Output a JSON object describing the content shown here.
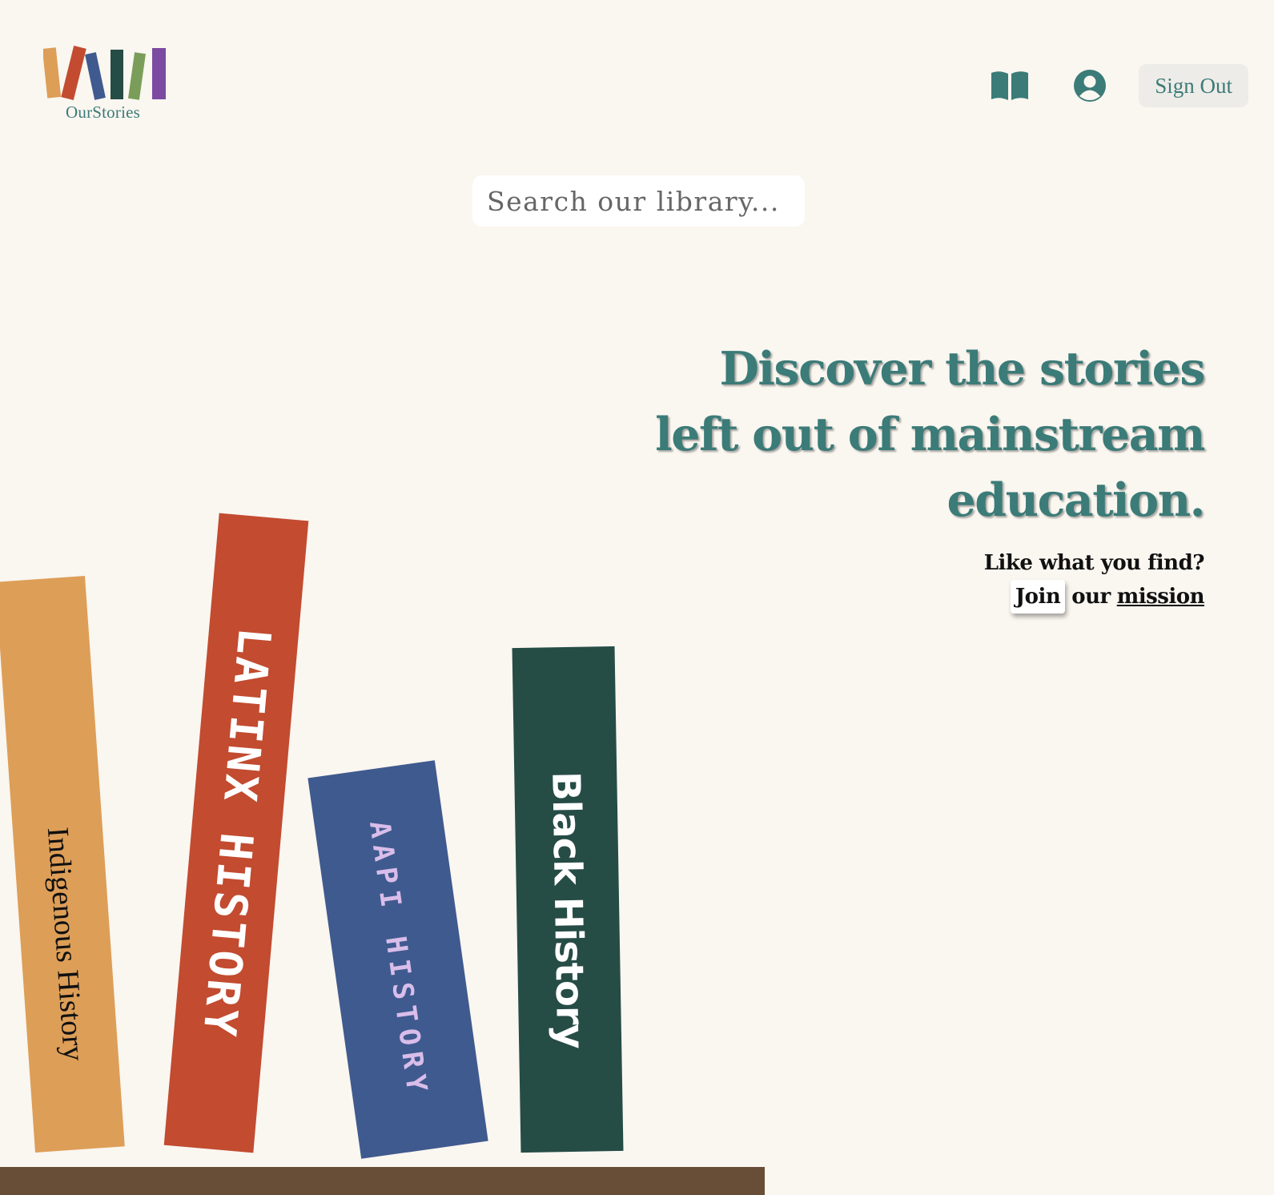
{
  "brand": {
    "name": "OurStories",
    "logo_bar_colors": [
      "#dd9e57",
      "#c24b30",
      "#3f5a8e",
      "#264c46",
      "#7a9e59",
      "#7c4aa0"
    ]
  },
  "nav": {
    "library_icon": "open-book-icon",
    "account_icon": "user-circle-icon",
    "sign_out_label": "Sign Out"
  },
  "search": {
    "placeholder": "Search our library..."
  },
  "hero": {
    "headline_lines": [
      "Discover the stories",
      "left out of mainstream",
      "education."
    ],
    "prompt": "Like what you find?",
    "join_label": "Join",
    "our_text": "our",
    "mission_label": "mission"
  },
  "books": [
    {
      "label": "Indigenous History",
      "color": "#dd9e57",
      "text_color": "#111111"
    },
    {
      "label": "LATINX HISTORY",
      "color": "#c24b30",
      "text_color": "#ffffff"
    },
    {
      "label": "AAPI HISTORY",
      "color": "#3f5a8e",
      "text_color": "#d9bdea"
    },
    {
      "label": "Black History",
      "color": "#264c46",
      "text_color": "#ffffff"
    }
  ],
  "colors": {
    "background": "#faf6f0",
    "accent": "#3b7b78",
    "shelf": "#684e36"
  }
}
